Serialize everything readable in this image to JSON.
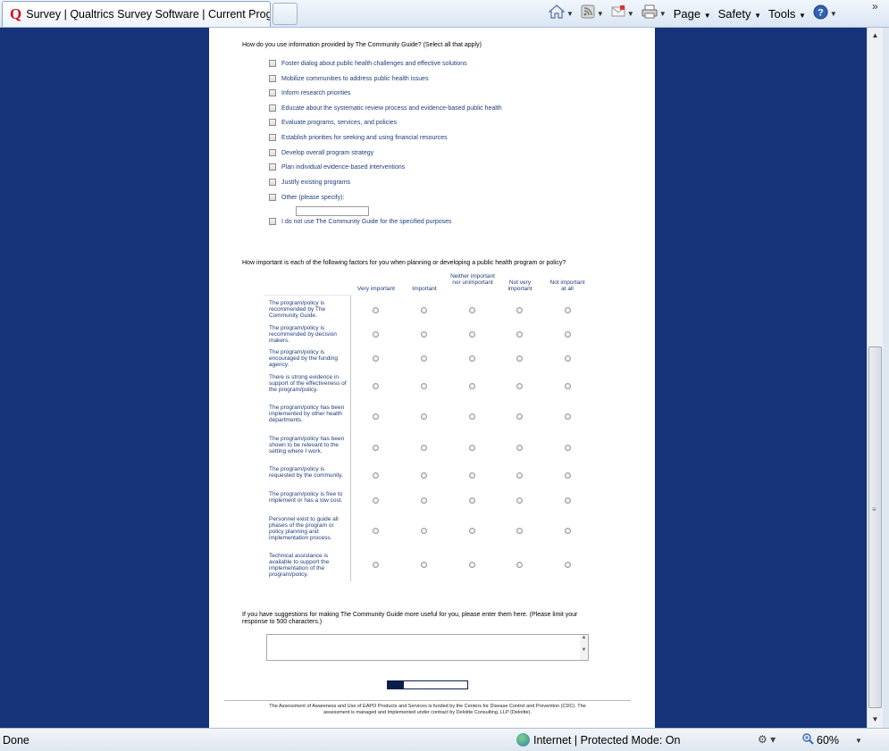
{
  "browser": {
    "tab_title": "Survey | Qualtrics Survey Software | Current Progr...",
    "tab_logo": "Q",
    "menus": [
      "Page",
      "Safety",
      "Tools"
    ],
    "icons": [
      "home-icon",
      "feeds-icon",
      "mail-icon",
      "print-icon",
      "help-icon"
    ]
  },
  "question1": {
    "text": "How do you use information provided by The Community Guide? (Select all that apply)",
    "options": [
      "Foster dialog about public health challenges and effective solutions",
      "Mobilize communities to address public health issues",
      "Inform research priorities",
      "Educate about the systematic review process and evidence-based public health",
      "Evaluate programs, services, and policies",
      "Establish priorities for seeking and using financial resources",
      "Develop overall program strategy",
      "Plan individual evidence-based interventions",
      "Justify existing programs",
      "Other (please specify):",
      "I do not use The Community Guide for the specified purposes"
    ],
    "other_value": ""
  },
  "question2": {
    "text": "How important is each of the following factors for you when planning or developing a public health program or policy?",
    "columns": [
      "Very important",
      "Important",
      "Neither important nor unimportant",
      "Not very important",
      "Not important at all"
    ],
    "rows": [
      "The program/policy is recommended by The Community Guide.",
      "The program/policy is recommended by decision makers.",
      "The program/policy is encouraged by the funding agency.",
      "There is strong evidence in support of the effectiveness of the program/policy.",
      "The program/policy has been implemented by other health departments.",
      "The program/policy has been shown to be relevant to the setting where I work.",
      "The program/policy is requested by the community.",
      "The program/policy is free to implement or has a low cost.",
      "Personnel exist to guide all phases of the program or policy planning and implementation process.",
      "Technical assistance is available to support the implementation of the program/policy."
    ]
  },
  "question3": {
    "text": "If you have suggestions for making The Community Guide more useful for you, please enter them here. (Please limit your response to 500 characters.)",
    "value": ""
  },
  "progress": {
    "fraction": 0.2
  },
  "footer": {
    "text": "The Assessment of Awareness and Use of EAPO Products and Services is funded by the Centers for Disease Control and Prevention (CDC). The assessment is managed and implemented under contract by Deloitte Consulting, LLP (Deloitte)."
  },
  "statusbar": {
    "status": "Done",
    "zone": "Internet | Protected Mode: On",
    "zoom": "60%"
  }
}
